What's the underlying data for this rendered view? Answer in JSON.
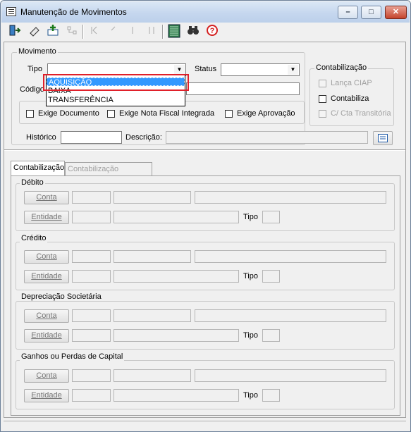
{
  "window": {
    "title": "Manutenção de Movimentos",
    "min_label": "–",
    "max_label": "□",
    "close_label": "✕"
  },
  "toolbar": [
    "exit-icon",
    "eraser-icon",
    "add-icon",
    "tree-icon",
    "first-icon",
    "prev-icon",
    "next-icon",
    "last-icon",
    "list-icon",
    "binoculars-icon",
    "help-icon"
  ],
  "movimento": {
    "group_label": "Movimento",
    "tipo_label": "Tipo",
    "tipo_value": "",
    "status_label": "Status",
    "status_value": "",
    "codigo_label": "Código",
    "codigo_value": "",
    "exige_documento": "Exige Documento",
    "exige_nota": "Exige Nota Fiscal Integrada",
    "exige_aprovacao": "Exige Aprovação",
    "historico_label": "Histórico",
    "historico_value": "",
    "descricao_label": "Descrição:",
    "descricao_value": ""
  },
  "tipo_options": [
    "AQUISIÇÃO",
    "BAIXA",
    "TRANSFERÊNCIA"
  ],
  "contabilizacao_group": {
    "label": "Contabilização",
    "lanca_ciap": "Lança CIAP",
    "contabiliza": "Contabiliza",
    "cta_transitoria": "C/ Cta Transitória"
  },
  "tabs": [
    "Contabilização",
    "Contabilização Gerencial"
  ],
  "sections": [
    {
      "label": "Débito",
      "conta": "Conta",
      "entidade": "Entidade",
      "tipo": "Tipo"
    },
    {
      "label": "Crédito",
      "conta": "Conta",
      "entidade": "Entidade",
      "tipo": "Tipo"
    },
    {
      "label": "Depreciação Societária",
      "conta": "Conta",
      "entidade": "Entidade",
      "tipo": "Tipo"
    },
    {
      "label": "Ganhos ou Perdas de Capital",
      "conta": "Conta",
      "entidade": "Entidade",
      "tipo": "Tipo"
    }
  ]
}
